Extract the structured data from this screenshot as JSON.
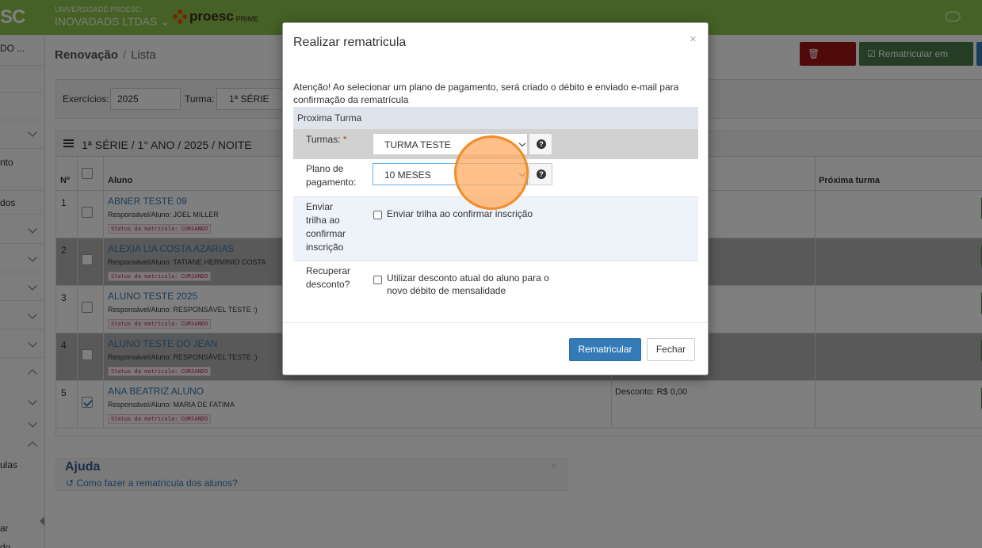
{
  "topbar": {
    "logo_fragment": "SC",
    "university_label": "UNIVERSIDADE PROESC:",
    "university_name": "INOVADADS LTDAS",
    "brand_name": "proesc",
    "brand_suffix": "PRIME"
  },
  "sidebar": {
    "items": [
      "DO ...",
      "nto",
      "dos",
      "ulas",
      "ar",
      "do"
    ]
  },
  "breadcrumb": {
    "section": "Renovação",
    "page": "Lista"
  },
  "toolbar": {
    "delete_label": "Excluir",
    "batch_label": "Rematricular em lote"
  },
  "filters": {
    "exercise_label": "Exercícios:",
    "exercise_value": "2025",
    "class_label": "Turma:",
    "class_value": "1ª SÉRIE"
  },
  "table": {
    "title": "1ª SÉRIE / 1° ANO / 2025 / NOITE",
    "headers": {
      "num": "Nº",
      "student": "Aluno",
      "next_class": "Próxima turma"
    },
    "rows": [
      {
        "num": "1",
        "name": "ABNER TESTE 09",
        "resp": "Responsável/Aluno: JOEL MILLER",
        "status": "Status da matricula: CURSANDO",
        "checked": false,
        "discount": ""
      },
      {
        "num": "2",
        "name": "ALEXIA LIA COSTA AZARIAS",
        "resp": "Responsável/Aluno: TATIANE HERMINIO COSTA",
        "status": "Status da matricula: CURSANDO",
        "checked": false,
        "discount": ""
      },
      {
        "num": "3",
        "name": "ALUNO TESTE 2025",
        "resp": "Responsável/Aluno: RESPONSÁVEL TESTE :)",
        "status": "Status da matricula: CURSANDO",
        "checked": false,
        "discount": ""
      },
      {
        "num": "4",
        "name": "ALUNO TESTE DO JEAN",
        "resp": "Responsável/Aluno: RESPONSÁVEL TESTE :)",
        "status": "Status da matricula: CURSANDO",
        "checked": false,
        "discount": ""
      },
      {
        "num": "5",
        "name": "ANA BEATRIZ ALUNO",
        "resp": "Responsável/Aluno: MARIA DE FATIMA",
        "status": "Status da matricula: CURSANDO",
        "checked": true,
        "discount": "Desconto: R$ 0,00"
      }
    ]
  },
  "help": {
    "title": "Ajuda",
    "link": "Como fazer a rematrícula dos alunos?",
    "close": "×"
  },
  "modal": {
    "title": "Realizar rematricula",
    "close": "×",
    "warning": "Atenção! Ao selecionar um plano de pagamento, será criado o débito e enviado e-mail para confirmação da rematrícula",
    "section": "Proxima Turma",
    "turmas_label": "Turmas:",
    "turmas_required": "*",
    "turmas_value": "TURMA TESTE",
    "plano_label": "Plano de pagamento:",
    "plano_value": "10 MESES",
    "trilha_label": "Enviar trilha ao confirmar inscrição",
    "trilha_check_text": "Enviar trilha ao confirmar inscrição",
    "desconto_label": "Recuperar desconto?",
    "desconto_check_text": "Utilizar desconto atual do aluno para o novo débito de mensalidade",
    "submit_label": "Rematricular",
    "cancel_label": "Fechar"
  },
  "colors": {
    "topbar": "#8bc34a",
    "primary": "#337ab7",
    "danger": "#a01515",
    "success": "#4b7a4b"
  }
}
